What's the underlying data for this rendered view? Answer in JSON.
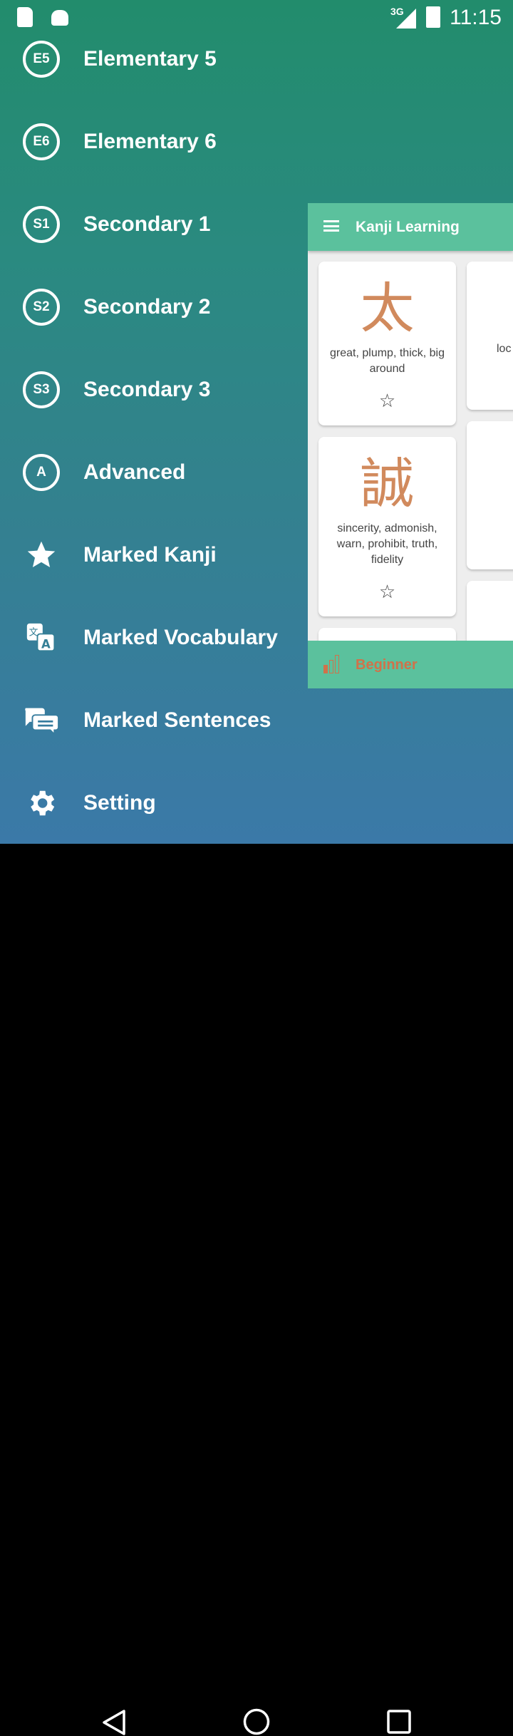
{
  "status_bar": {
    "network": "3G",
    "time": "11:15"
  },
  "drawer": {
    "items": [
      {
        "badge": "E5",
        "label": "Elementary 5",
        "icon": "circle-badge"
      },
      {
        "badge": "E6",
        "label": "Elementary 6",
        "icon": "circle-badge"
      },
      {
        "badge": "S1",
        "label": "Secondary 1",
        "icon": "circle-badge"
      },
      {
        "badge": "S2",
        "label": "Secondary 2",
        "icon": "circle-badge"
      },
      {
        "badge": "S3",
        "label": "Secondary 3",
        "icon": "circle-badge"
      },
      {
        "badge": "A",
        "label": "Advanced",
        "icon": "circle-badge"
      },
      {
        "label": "Marked Kanji",
        "icon": "star-icon"
      },
      {
        "label": "Marked Vocabulary",
        "icon": "translate-icon"
      },
      {
        "label": "Marked Sentences",
        "icon": "chat-icon"
      },
      {
        "label": "Setting",
        "icon": "gear-icon"
      }
    ]
  },
  "app": {
    "title": "Kanji Learning",
    "cards": [
      {
        "kanji": "太",
        "meaning": "great, plump, thick, big around",
        "marked": false
      },
      {
        "kanji": "誠",
        "meaning": "sincerity, admonish, warn, prohibit, truth, fidelity",
        "marked": false
      }
    ],
    "partial_card_text": "loc",
    "level": "Beginner",
    "colors": {
      "accent": "#5bc19d",
      "kanji": "#d18a5d",
      "level": "#d0724a"
    }
  }
}
